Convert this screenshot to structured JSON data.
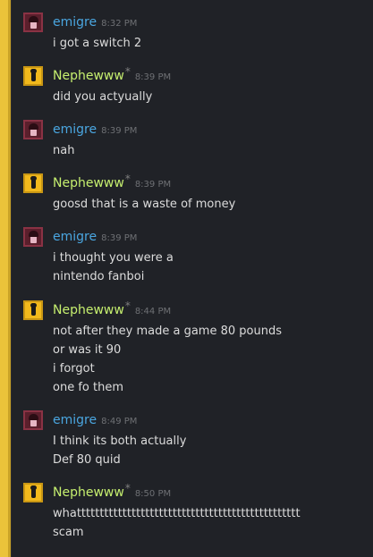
{
  "colors": {
    "accent_bar": "#ebc33a",
    "emigre_name": "#4aa6e0",
    "nephewww_name": "#c6ef6f",
    "timestamp": "#6e7074",
    "message_text": "#dcdcdc",
    "background": "#202227"
  },
  "messages": [
    {
      "author": "emigre",
      "avatar_icon": "pink-character-avatar-icon",
      "star": "",
      "time": "8:32 PM",
      "lines": [
        "i got a switch 2"
      ]
    },
    {
      "author": "Nephewww",
      "avatar_icon": "gold-character-avatar-icon",
      "star": "*",
      "time": "8:39 PM",
      "lines": [
        "did you actyually"
      ]
    },
    {
      "author": "emigre",
      "avatar_icon": "pink-character-avatar-icon",
      "star": "",
      "time": "8:39 PM",
      "lines": [
        "nah"
      ]
    },
    {
      "author": "Nephewww",
      "avatar_icon": "gold-character-avatar-icon",
      "star": "*",
      "time": "8:39 PM",
      "lines": [
        "goosd that is a waste of money"
      ]
    },
    {
      "author": "emigre",
      "avatar_icon": "pink-character-avatar-icon",
      "star": "",
      "time": "8:39 PM",
      "lines": [
        "i thought you were a",
        "nintendo fanboi"
      ]
    },
    {
      "author": "Nephewww",
      "avatar_icon": "gold-character-avatar-icon",
      "star": "*",
      "time": "8:44 PM",
      "lines": [
        "not after they made a game 80 pounds",
        "or was it 90",
        "i forgot",
        "one fo them"
      ]
    },
    {
      "author": "emigre",
      "avatar_icon": "pink-character-avatar-icon",
      "star": "",
      "time": "8:49 PM",
      "lines": [
        "I think its both actually",
        "Def 80 quid"
      ]
    },
    {
      "author": "Nephewww",
      "avatar_icon": "gold-character-avatar-icon",
      "star": "*",
      "time": "8:50 PM",
      "lines": [
        "whattttttttttttttttttttttttttttttttttttttttttttttttt",
        "scam"
      ]
    }
  ]
}
